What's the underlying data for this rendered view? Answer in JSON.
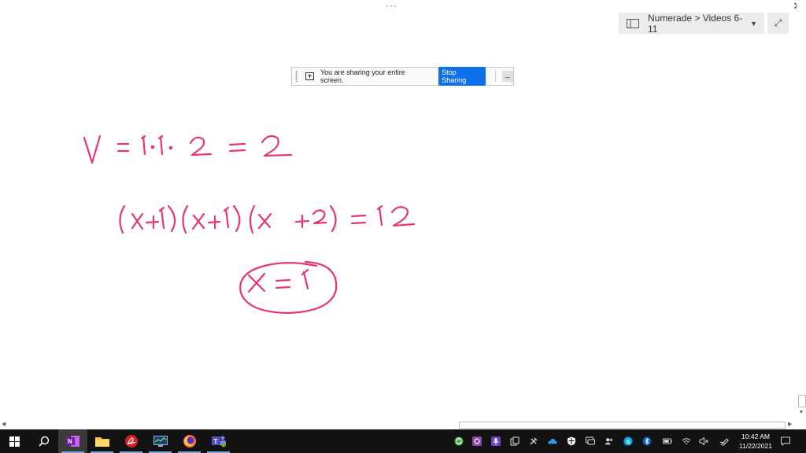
{
  "window": {
    "more_dots": "···",
    "close_icon": "close-icon"
  },
  "notebook": {
    "breadcrumb": "Numerade > Videos 6-11",
    "icon": "notebook-icon",
    "dropdown_icon": "chevron-down-icon",
    "expand_icon": "expand-icon"
  },
  "share_bar": {
    "message": "You are sharing your entire screen.",
    "stop_label": "Stop Sharing",
    "minimize_label": "_",
    "accent": "#0e71eb"
  },
  "canvas": {
    "ink_color": "#e8347a",
    "handwriting": [
      "V = 1·1·2 = 2",
      "(x+1)(x+1)(x+2) = 12",
      "x = 1"
    ]
  },
  "taskbar": {
    "apps": [
      "Start",
      "Search",
      "OneNote",
      "File Explorer",
      "Acrobat",
      "Task Manager",
      "Firefox",
      "Teams"
    ],
    "clock_time": "10:42 AM",
    "clock_date": "11/22/2021"
  }
}
